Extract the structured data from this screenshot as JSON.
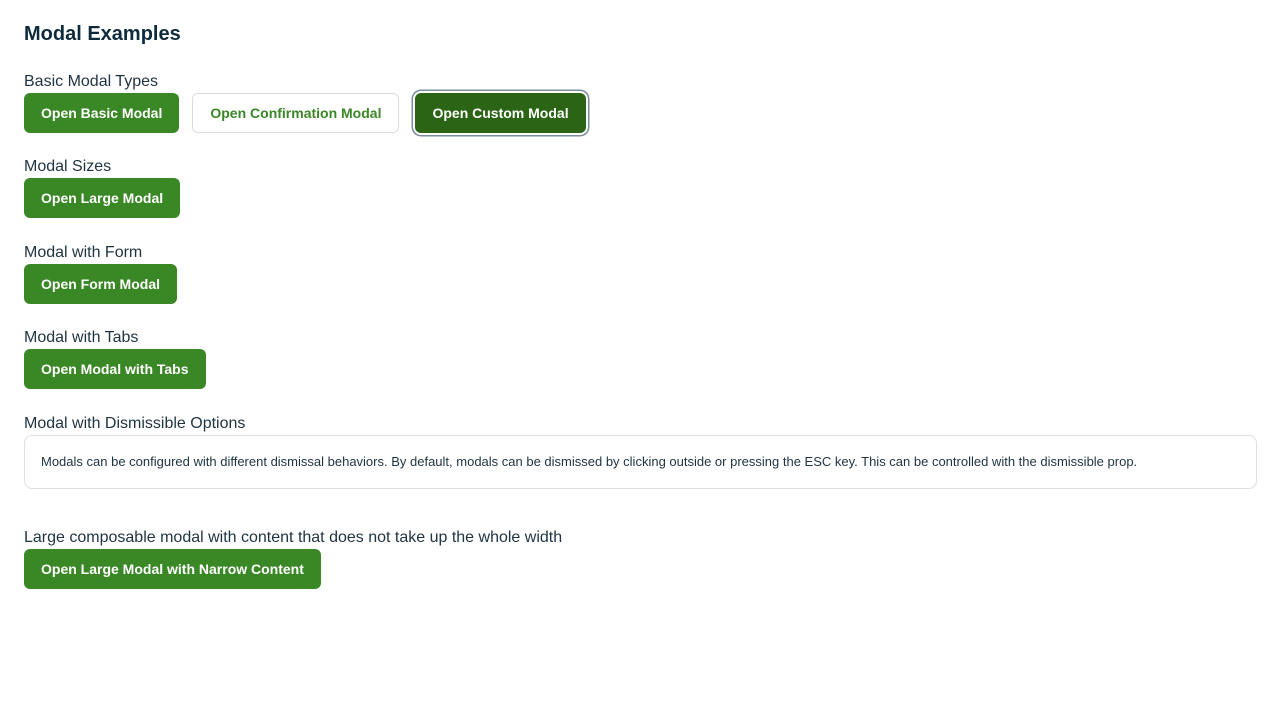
{
  "title": "Modal Examples",
  "sections": [
    {
      "label": "Basic Modal Types",
      "buttons": [
        "Open Basic Modal",
        "Open Confirmation Modal",
        "Open Custom Modal"
      ]
    },
    {
      "label": "Modal Sizes",
      "buttons": [
        "Open Large Modal"
      ]
    },
    {
      "label": "Modal with Form",
      "buttons": [
        "Open Form Modal"
      ]
    },
    {
      "label": "Modal with Tabs",
      "buttons": [
        "Open Modal with Tabs"
      ]
    },
    {
      "label": "Modal with Dismissible Options",
      "description": "Modals can be configured with different dismissal behaviors. By default, modals can be dismissed by clicking outside or pressing the ESC key. This can be controlled with the dismissible prop."
    },
    {
      "label": "Large composable modal with content that does not take up the whole width",
      "buttons": [
        "Open Large Modal with Narrow Content"
      ]
    }
  ],
  "colors": {
    "primary": "#3a8726",
    "primary_dark": "#2a6414",
    "heading": "#0d2b3c"
  }
}
